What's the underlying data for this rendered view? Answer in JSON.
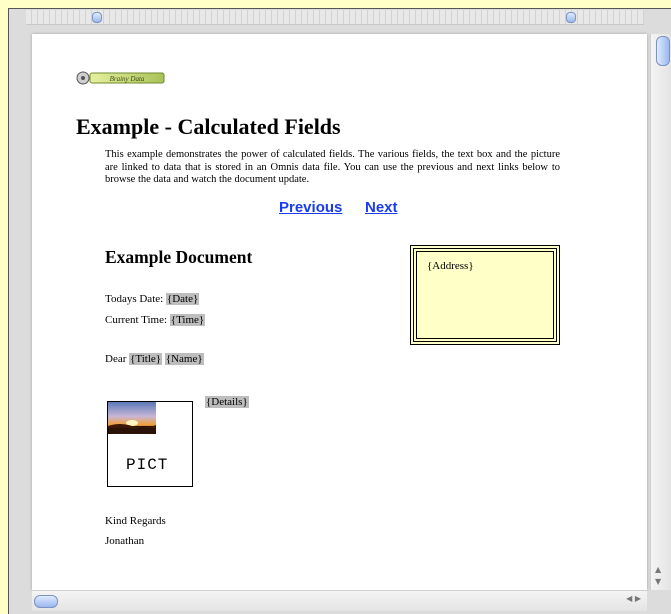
{
  "logo": {
    "text": "Brainy Data"
  },
  "document": {
    "title": "Example - Calculated Fields",
    "intro": "This example demonstrates the power of calculated fields. The various fields, the text box and the picture are linked to data that is stored in an Omnis data file. You can use the previous and next links below to browse the data and watch the document update.",
    "nav": {
      "previous": "Previous",
      "next": "Next"
    },
    "example_heading": "Example Document",
    "date_label": "Todays Date:",
    "date_field": "{Date}",
    "time_label": "Current Time:",
    "time_field": "{Time}",
    "greeting": "Dear",
    "title_field": "{Title}",
    "name_field": "{Name}",
    "address_field": "{Address}",
    "picture_label": "PICT",
    "details_field": "{Details}",
    "closing": "Kind Regards",
    "signature": "Jonathan"
  },
  "colors": {
    "background": "#ffffc8",
    "link": "#1a3cf0",
    "field_highlight": "#bdbdbd",
    "address_fill": "#ffffc8"
  }
}
